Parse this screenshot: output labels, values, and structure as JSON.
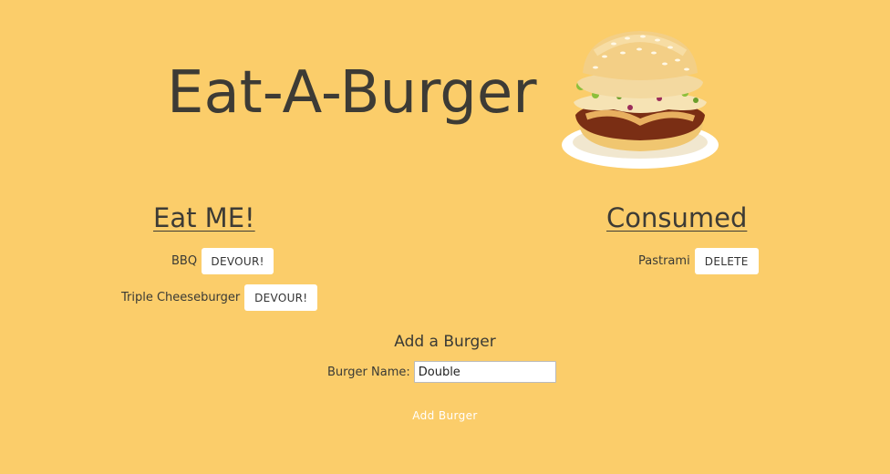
{
  "header": {
    "title": "Eat-A-Burger",
    "logo_icon": "burger-icon"
  },
  "eat_column": {
    "heading": "Eat ME!",
    "items": [
      {
        "name": "BBQ",
        "button_label": "DEVOUR!"
      },
      {
        "name": "Triple Cheeseburger",
        "button_label": "DEVOUR!"
      }
    ]
  },
  "consumed_column": {
    "heading": "Consumed",
    "items": [
      {
        "name": "Pastrami",
        "button_label": "DELETE"
      }
    ]
  },
  "form": {
    "title": "Add a Burger",
    "label": "Burger Name:",
    "input_value": "Double",
    "submit_label": "Add Burger"
  },
  "colors": {
    "background": "#fbcd6a",
    "text": "#3d3b35",
    "button_bg": "#ffffff"
  }
}
